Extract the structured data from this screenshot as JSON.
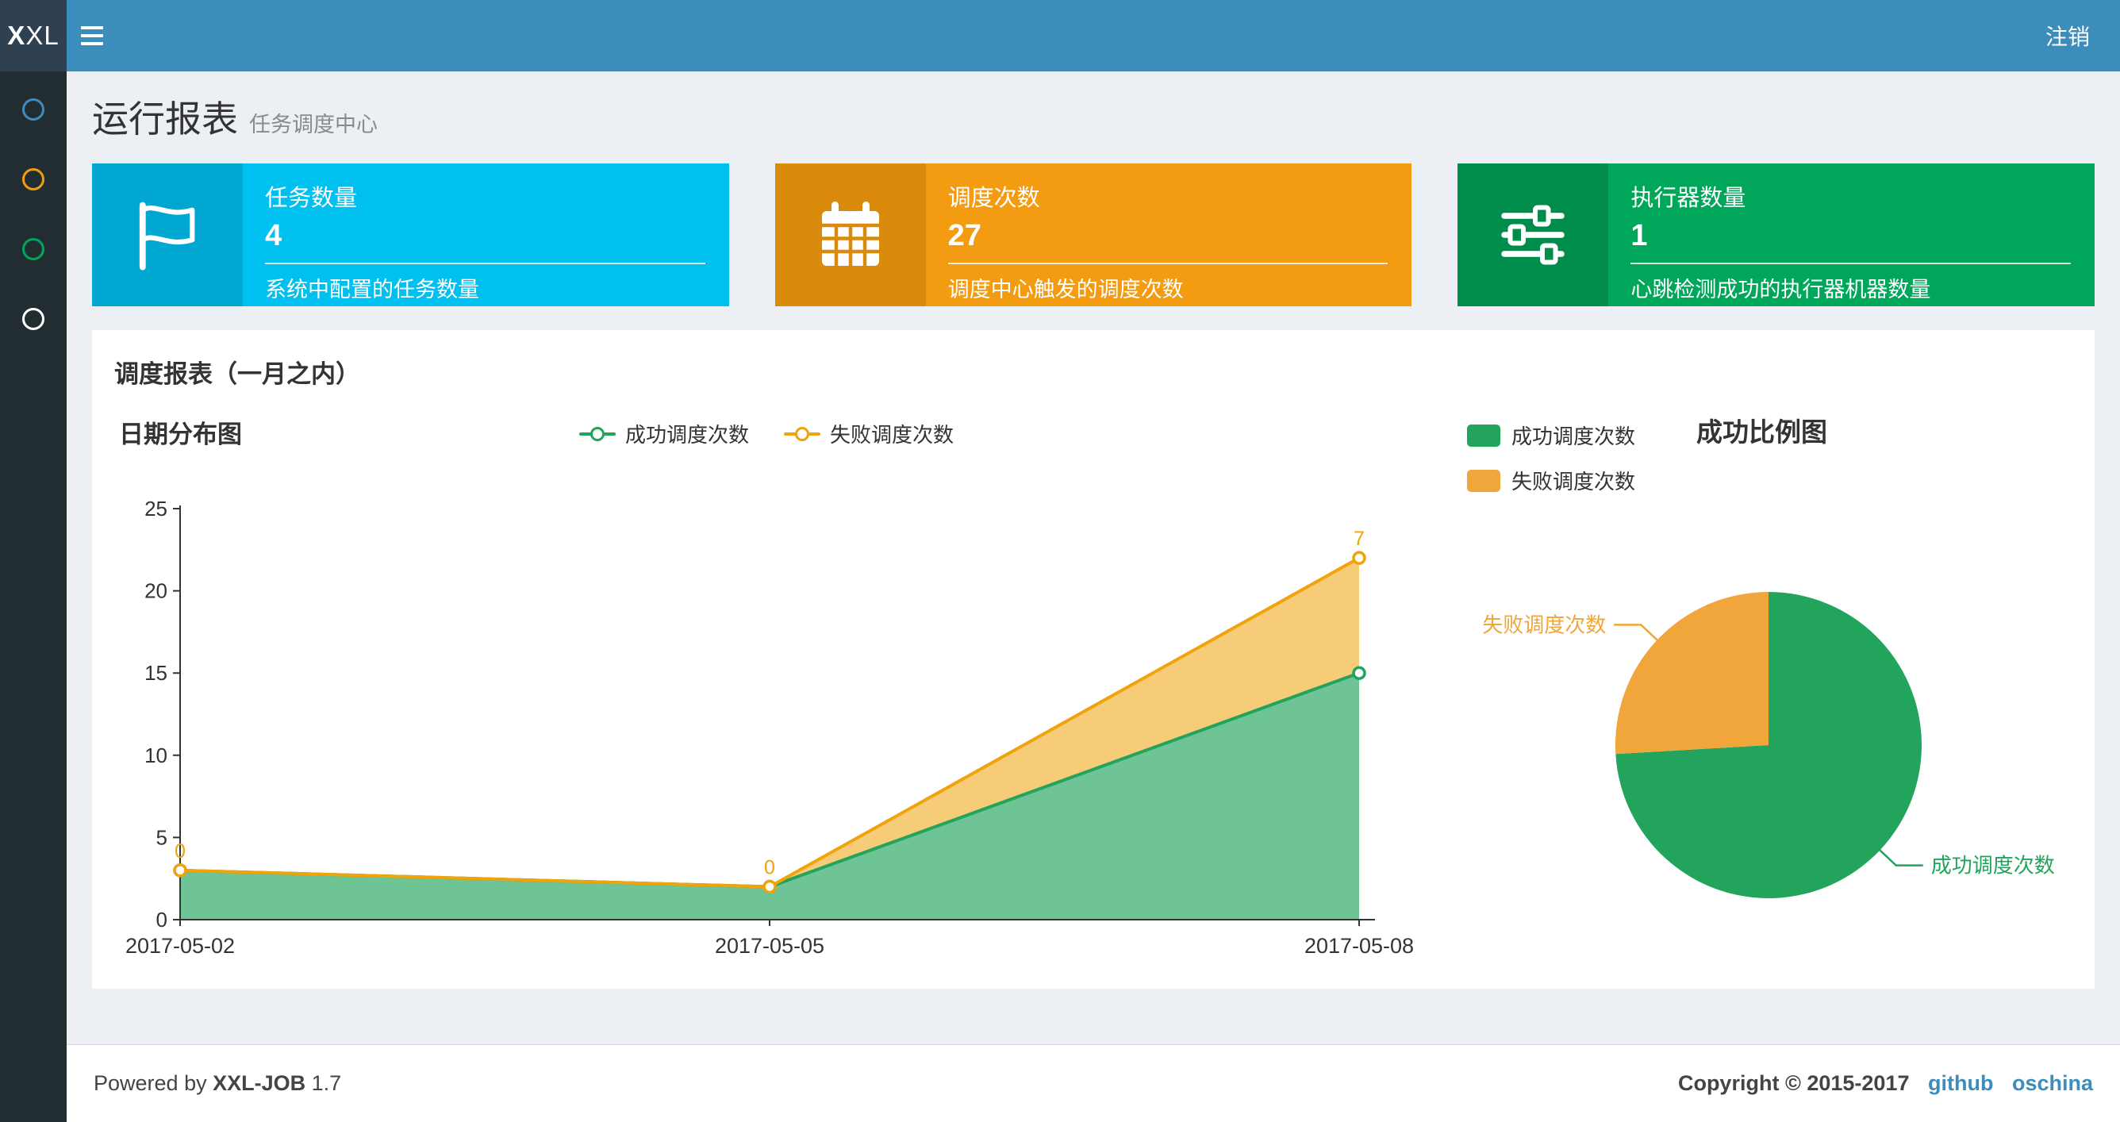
{
  "navbar": {
    "logo_bold": "X",
    "logo_rest": "XL",
    "logout_label": "注销"
  },
  "sidebar": {
    "items": [
      {
        "name": "menu-item-1",
        "color": "#3c8dbc"
      },
      {
        "name": "menu-item-2",
        "color": "#f39c12"
      },
      {
        "name": "menu-item-3",
        "color": "#00a65a"
      },
      {
        "name": "menu-item-4",
        "color": "#ffffff"
      }
    ]
  },
  "header": {
    "title": "运行报表",
    "subtitle": "任务调度中心"
  },
  "info_boxes": [
    {
      "icon": "flag-icon",
      "label": "任务数量",
      "value": "4",
      "description": "系统中配置的任务数量",
      "bg": "#00c0ef",
      "icon_bg": "#00a7d0"
    },
    {
      "icon": "calendar-icon",
      "label": "调度次数",
      "value": "27",
      "description": "调度中心触发的调度次数",
      "bg": "#f39c12",
      "icon_bg": "#db8b0b"
    },
    {
      "icon": "sliders-icon",
      "label": "执行器数量",
      "value": "1",
      "description": "心跳检测成功的执行器机器数量",
      "bg": "#00a65a",
      "icon_bg": "#008d4c"
    }
  ],
  "panel": {
    "title": "调度报表（一月之内）"
  },
  "chart_data": [
    {
      "type": "area",
      "title": "日期分布图",
      "x": [
        "2017-05-02",
        "2017-05-05",
        "2017-05-08"
      ],
      "series": [
        {
          "name": "成功调度次数",
          "values": [
            3,
            2,
            15
          ],
          "color": "#22a45c",
          "area_color": "rgba(34,164,92,0.65)",
          "stack": true
        },
        {
          "name": "失败调度次数",
          "values": [
            0,
            0,
            7
          ],
          "color": "#f0a30a",
          "area_color": "rgba(240,163,10,0.55)",
          "stack": true,
          "point_labels": [
            "0",
            "0",
            "7"
          ]
        }
      ],
      "ylim": [
        0,
        25
      ],
      "yticks": [
        0,
        5,
        10,
        15,
        20,
        25
      ],
      "legend": [
        "成功调度次数",
        "失败调度次数"
      ],
      "legend_position": "top-center",
      "grid": false
    },
    {
      "type": "pie",
      "title": "成功比例图",
      "slices": [
        {
          "name": "成功调度次数",
          "value": 20,
          "color": "#22a45c"
        },
        {
          "name": "失败调度次数",
          "value": 7,
          "color": "#f0a63a"
        }
      ],
      "legend": [
        "成功调度次数",
        "失败调度次数"
      ],
      "legend_position": "top-left"
    }
  ],
  "footer": {
    "powered_prefix": "Powered by",
    "product": "XXL-JOB",
    "version": "1.7",
    "copyright": "Copyright © 2015-2017",
    "links": [
      {
        "label": "github"
      },
      {
        "label": "oschina"
      }
    ]
  }
}
